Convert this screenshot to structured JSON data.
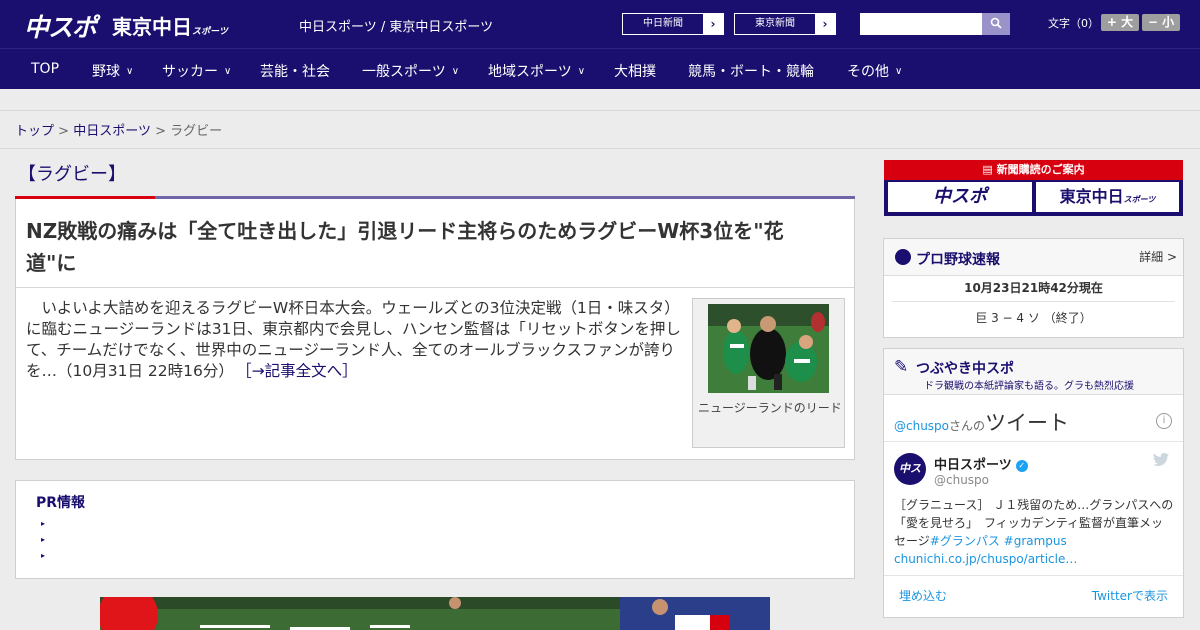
{
  "header": {
    "logo_chuspo": "中スポ",
    "logo_tokyo": "東京中日",
    "logo_tokyo_sub": "スポーツ",
    "site_title": "中日スポーツ / 東京中日スポーツ",
    "btn_chunichi": "中日新聞",
    "btn_tokyo": "東京新聞",
    "search_placeholder": "",
    "font_label": "文字（0）",
    "font_bigger": "+ 大",
    "font_smaller": "− 小"
  },
  "nav": [
    {
      "label": "TOP"
    },
    {
      "label": "野球",
      "dropdown": true
    },
    {
      "label": "サッカー",
      "dropdown": true
    },
    {
      "label": "芸能・社会"
    },
    {
      "label": "一般スポーツ",
      "dropdown": true
    },
    {
      "label": "地域スポーツ",
      "dropdown": true
    },
    {
      "label": "大相撲"
    },
    {
      "label": "競馬・ボート・競輪"
    },
    {
      "label": "その他",
      "dropdown": true
    }
  ],
  "breadcrumb": {
    "top": "トップ",
    "sep": ">",
    "chunichi": "中日スポーツ",
    "current": "ラグビー"
  },
  "category": {
    "title": "【ラグビー】"
  },
  "article": {
    "headline": "NZ敗戦の痛みは「全て吐き出した」引退リード主将らのためラグビーW杯3位を\"花道\"に",
    "body": "いよいよ大詰めを迎えるラグビーW杯日本大会。ウェールズとの3位決定戦（1日・味スタ）に臨むニュージーランドは31日、東京都内で会見し、ハンセン監督は「リセットボタンを押して、チームだけでなく、世界中のニュージーランド人、全てのオールブラックスファンが誇りを…（10月31日 22時16分）",
    "read_more": "［→記事全文へ］",
    "photo_caption": "ニュージーランドのリード"
  },
  "pr": {
    "title": "PR情報",
    "bullets": [
      "▸",
      "▸",
      "▸"
    ]
  },
  "sidebar": {
    "subscribe": {
      "title": "新聞購読のご案内",
      "logo_chuspo": "中スポ",
      "logo_tokyo": "東京中日",
      "logo_tokyo_sub": "スポーツ"
    },
    "baseball": {
      "title": "プロ野球速報",
      "detail": "詳細 >",
      "timestamp": "10月23日21時42分現在",
      "game": "巨 3 − 4 ソ （終了）"
    },
    "tweets": {
      "title": "つぶやき中スポ",
      "subtitle": "ドラ観戦の本紙評論家も語る。グラも熱烈応援",
      "handle": "@chuspo",
      "handle_suffix": "さんの",
      "tweet_word": "ツイート",
      "info": "i",
      "avatar_text": "中スポ",
      "account_name": "中日スポーツ",
      "account_handle": "@chuspo",
      "tweet_prefix": "［グラニュース］ Ｊ１残留のため…グランパスへの「愛を見せろ」　フィッカデンティ監督が直筆メッセージ",
      "tag1": "#グランパス",
      "tag2": "#grampus",
      "link": "chunichi.co.jp/chuspo/article…",
      "embed": "埋め込む",
      "view_on_twitter": "Twitterで表示"
    }
  },
  "colors": {
    "header_bg": "#1a0f6e",
    "accent_red": "#d7000f",
    "link_blue": "#1b95e0"
  }
}
